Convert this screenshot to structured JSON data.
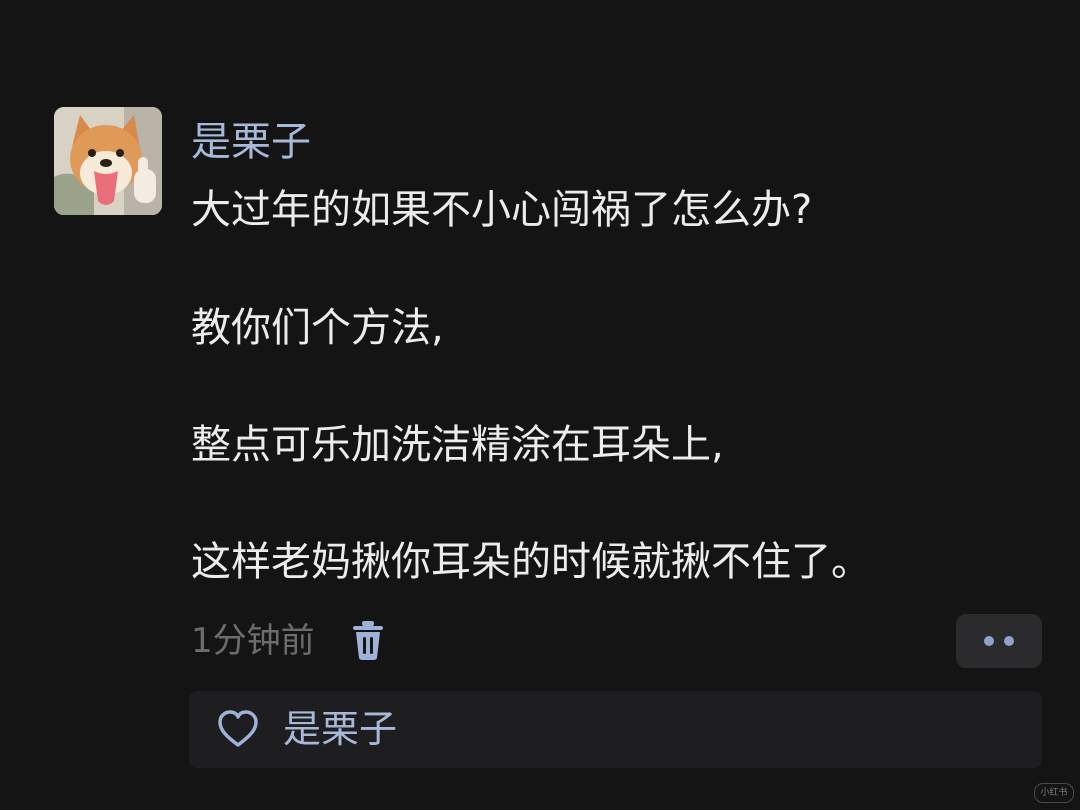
{
  "comment": {
    "author": "是栗子",
    "lines": [
      "大过年的如果不小心闯祸了怎么办?",
      "教你们个方法,",
      "整点可乐加洗洁精涂在耳朵上,",
      "这样老妈揪你耳朵的时候就揪不住了。"
    ],
    "time": "1分钟前",
    "icons": {
      "delete": "trash-icon",
      "more": "more-dots-icon",
      "like": "heart-icon"
    }
  },
  "likes": {
    "users": [
      "是栗子"
    ]
  },
  "watermark": "小红书",
  "colors": {
    "background": "#141414",
    "author": "#a7b8d9",
    "text": "#ececec",
    "meta": "#6c6c6c",
    "panel": "#1e1e20"
  }
}
